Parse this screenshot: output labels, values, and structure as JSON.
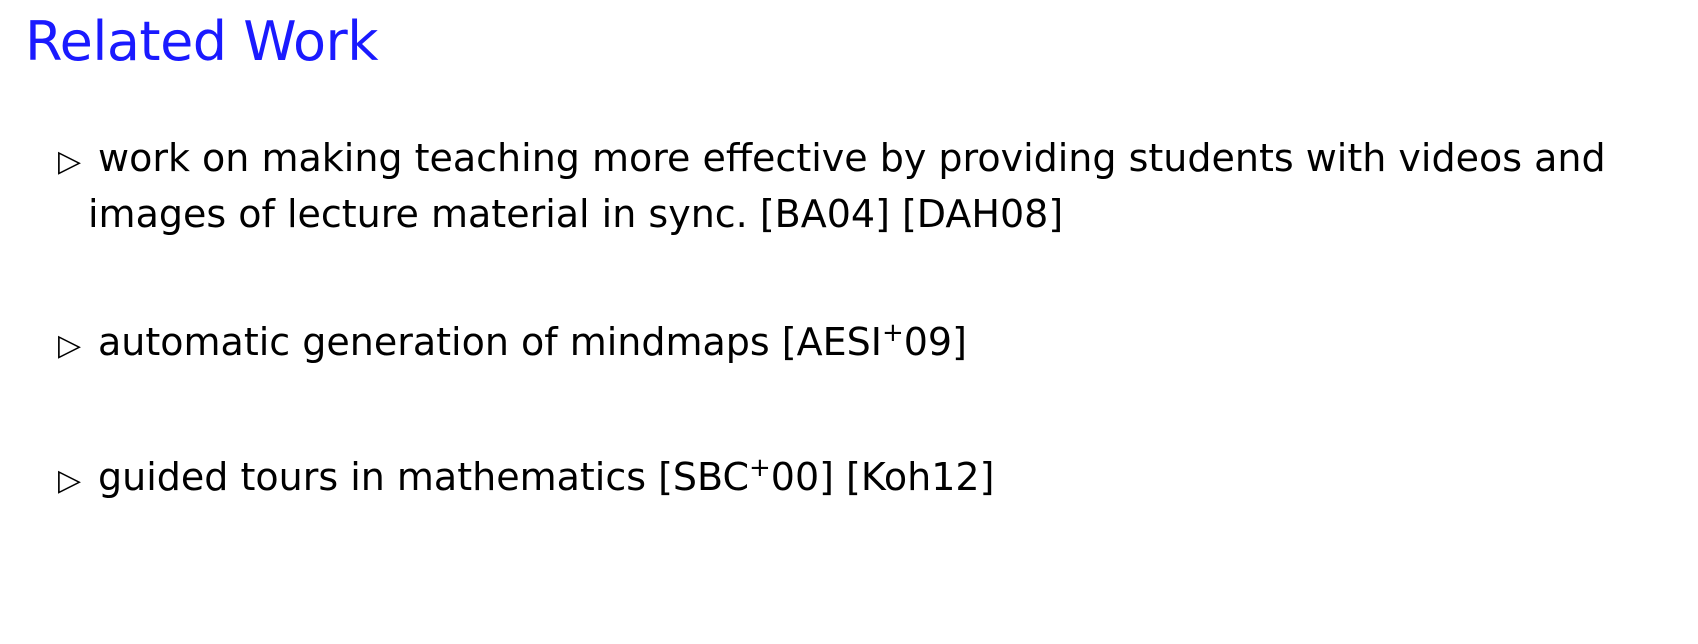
{
  "slide": {
    "title": "Related Work",
    "bullet_marker": "▷",
    "items": [
      {
        "line1": "work on making teaching more effective by providing students with videos and",
        "line2": "images of lecture material in sync. [BA04] [DAH08]"
      },
      {
        "text_before": "automatic generation of mindmaps [AESI",
        "superscript": "+",
        "text_after": "09]"
      },
      {
        "text_before": "guided tours in mathematics [SBC",
        "superscript": "+",
        "text_after": "00] [Koh12]"
      }
    ]
  },
  "colors": {
    "title": "#1a1aff",
    "text": "#000000",
    "background": "#ffffff"
  }
}
